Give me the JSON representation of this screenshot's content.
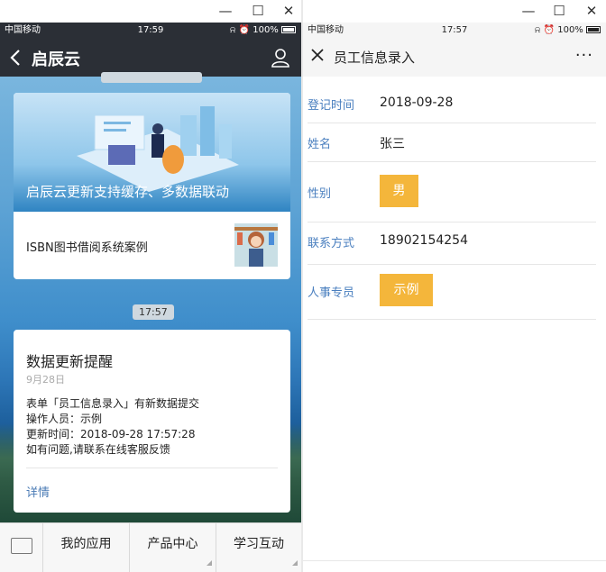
{
  "window": {
    "minimize_glyph": "—",
    "maximize_glyph": "☐",
    "close_glyph": "✕"
  },
  "left": {
    "status": {
      "carrier": "中国移动",
      "time": "17:59",
      "battery": "100%",
      "alarm_icons": "⍾ ⏰"
    },
    "header": {
      "title": "启辰云"
    },
    "news_card": {
      "banner_caption": "启辰云更新支持缓存、多数据联动",
      "item_title": "ISBN图书借阅系统案例"
    },
    "time_chip": "17:57",
    "notice": {
      "title": "数据更新提醒",
      "date": "9月28日",
      "lines": [
        "表单「员工信息录入」有新数据提交",
        "操作人员：示例",
        "更新时间：2018-09-28 17:57:28",
        "如有问题,请联系在线客服反馈"
      ],
      "detail_label": "详情"
    },
    "footer": {
      "menus": [
        "我的应用",
        "产品中心",
        "学习互动"
      ]
    }
  },
  "right": {
    "status": {
      "carrier": "中国移动",
      "time": "17:57",
      "battery": "100%",
      "alarm_icons": "⍾ ⏰"
    },
    "header": {
      "title": "员工信息录入",
      "more": "···"
    },
    "form": {
      "fields": [
        {
          "label": "登记时间",
          "value": "2018-09-28"
        },
        {
          "label": "姓名",
          "value": "张三"
        },
        {
          "label": "性别",
          "value": "男"
        },
        {
          "label": "联系方式",
          "value": "18902154254"
        },
        {
          "label": "人事专员",
          "value": "示例"
        }
      ]
    }
  },
  "colors": {
    "wechat_header": "#2b2f36",
    "accent_chip": "#f4b63b",
    "label_blue": "#4a7fbf",
    "link_blue": "#4a7bb5"
  }
}
